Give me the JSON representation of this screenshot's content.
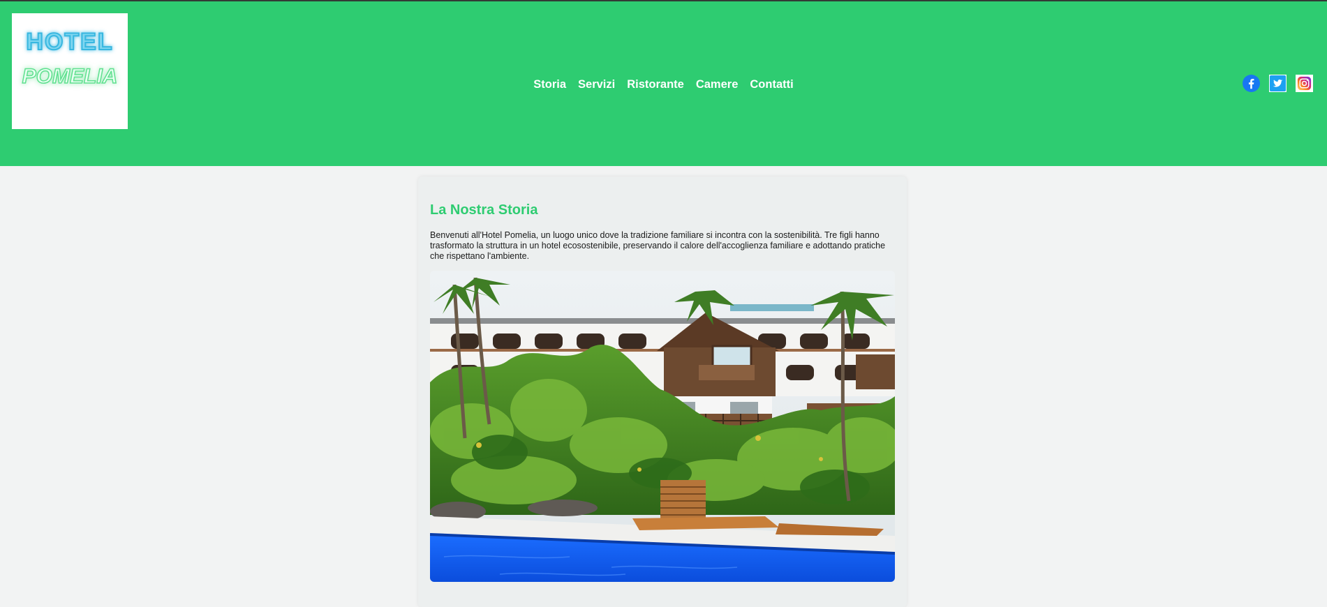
{
  "header": {
    "logo": {
      "line1": "HOTEL",
      "line2": "POMELIA"
    },
    "nav": [
      {
        "label": "Storia"
      },
      {
        "label": "Servizi"
      },
      {
        "label": "Ristorante"
      },
      {
        "label": "Camere"
      },
      {
        "label": "Contatti"
      }
    ],
    "socials": [
      {
        "icon": "facebook-icon",
        "color": "#1877f2"
      },
      {
        "icon": "twitter-icon",
        "color": "#1da1f2"
      },
      {
        "icon": "instagram-icon",
        "color": "#c13584"
      }
    ]
  },
  "main": {
    "title": "La Nostra Storia",
    "paragraph": "Benvenuti all'Hotel Pomelia, un luogo unico dove la tradizione familiare si incontra con la sostenibilità. Tre figli hanno trasformato la struttura in un hotel ecosostenibile, preservando il calore dell'accoglienza familiare e adottando pratiche che rispettano l'ambiente.",
    "image": "hotel-photo"
  },
  "colors": {
    "brand_green": "#2ecc71",
    "page_bg": "#f2f3f3",
    "card_bg": "#ecefef",
    "logo_neon": "#4fc3e8"
  }
}
